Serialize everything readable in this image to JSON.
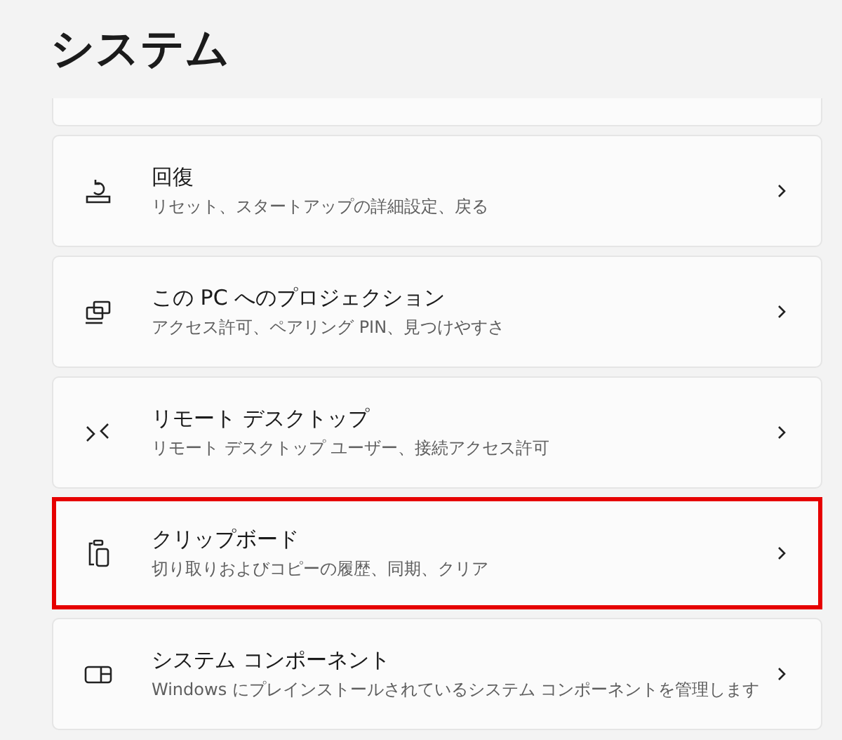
{
  "page_title": "システム",
  "items": [
    {
      "title": "回復",
      "subtitle": "リセット、スタートアップの詳細設定、戻る",
      "highlighted": false
    },
    {
      "title": "この PC へのプロジェクション",
      "subtitle": "アクセス許可、ペアリング PIN、見つけやすさ",
      "highlighted": false
    },
    {
      "title": "リモート デスクトップ",
      "subtitle": "リモート デスクトップ ユーザー、接続アクセス許可",
      "highlighted": false
    },
    {
      "title": "クリップボード",
      "subtitle": "切り取りおよびコピーの履歴、同期、クリア",
      "highlighted": true
    },
    {
      "title": "システム コンポーネント",
      "subtitle": "Windows にプレインストールされているシステム コンポーネントを管理します",
      "highlighted": false
    }
  ]
}
